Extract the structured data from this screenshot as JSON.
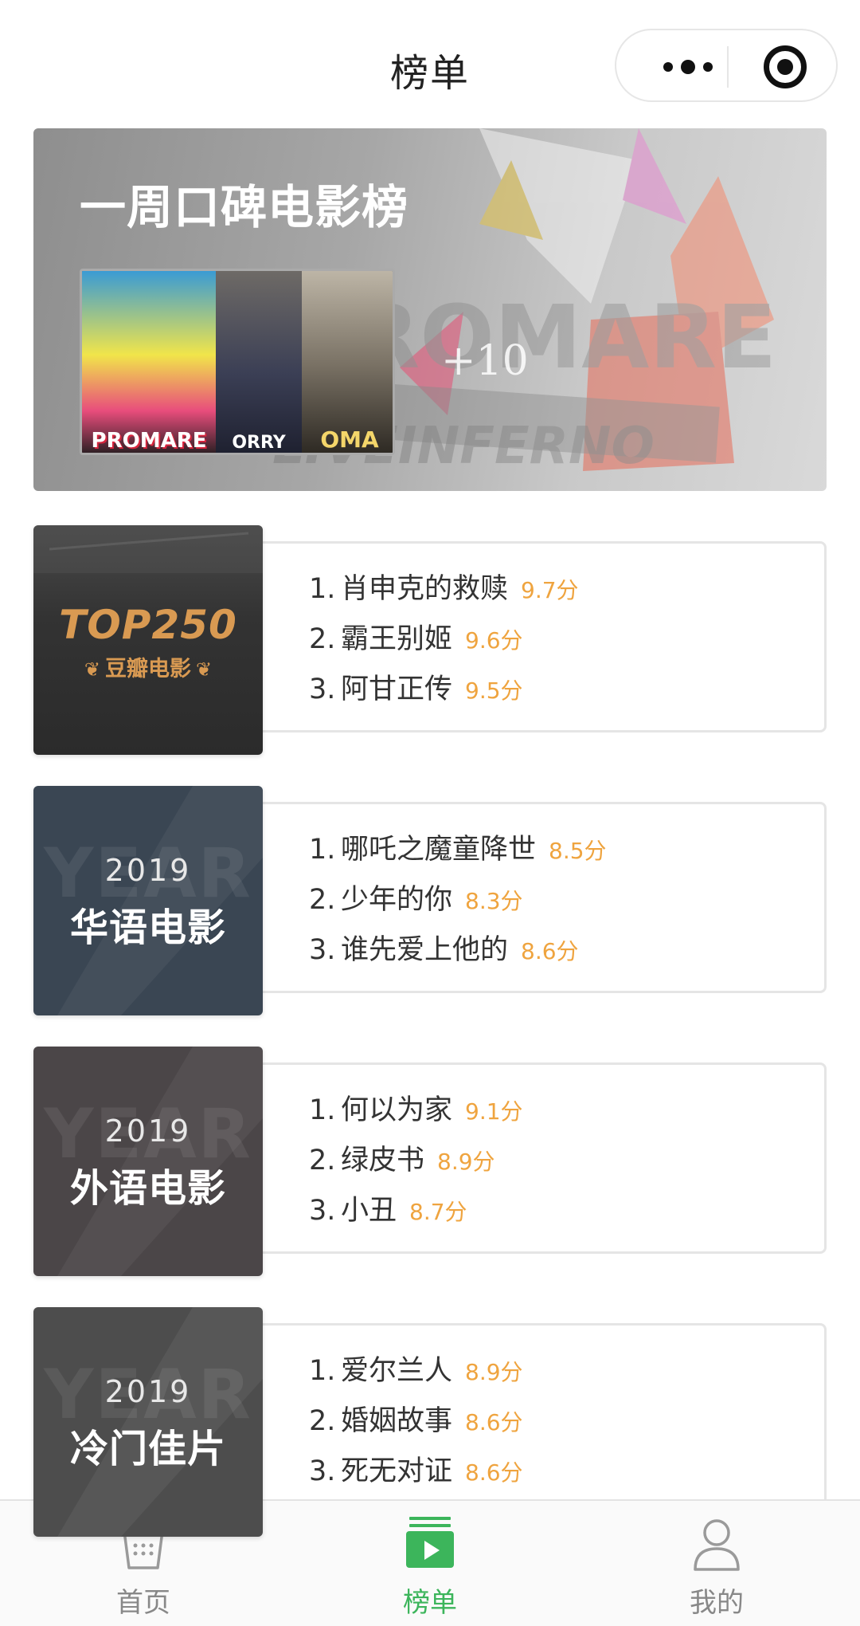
{
  "nav": {
    "title": "榜单"
  },
  "banner": {
    "title": "一周口碑电影榜",
    "more": "+10",
    "posters": [
      {
        "caption": "PROMARE",
        "icon": "poster-promare"
      },
      {
        "caption": "ORRY",
        "icon": "poster-sorry-we-missed-you"
      },
      {
        "caption": "OMA",
        "icon": "poster-road-to-roma"
      }
    ]
  },
  "lists": [
    {
      "cover": {
        "logo": "TOP250",
        "sub": "豆瓣电影"
      },
      "items": [
        {
          "rank": "1.",
          "title": "肖申克的救赎",
          "score": "9.7分"
        },
        {
          "rank": "2.",
          "title": "霸王别姬",
          "score": "9.6分"
        },
        {
          "rank": "3.",
          "title": "阿甘正传",
          "score": "9.5分"
        }
      ]
    },
    {
      "cover": {
        "bg_text": "YEAR",
        "year": "2019",
        "name": "华语电影"
      },
      "items": [
        {
          "rank": "1.",
          "title": "哪吒之魔童降世",
          "score": "8.5分"
        },
        {
          "rank": "2.",
          "title": "少年的你",
          "score": "8.3分"
        },
        {
          "rank": "3.",
          "title": "谁先爱上他的",
          "score": "8.6分"
        }
      ]
    },
    {
      "cover": {
        "bg_text": "YEAR",
        "year": "2019",
        "name": "外语电影"
      },
      "items": [
        {
          "rank": "1.",
          "title": "何以为家",
          "score": "9.1分"
        },
        {
          "rank": "2.",
          "title": "绿皮书",
          "score": "8.9分"
        },
        {
          "rank": "3.",
          "title": "小丑",
          "score": "8.7分"
        }
      ]
    },
    {
      "cover": {
        "bg_text": "YEAR",
        "year": "2019",
        "name": "冷门佳片"
      },
      "items": [
        {
          "rank": "1.",
          "title": "爱尔兰人",
          "score": "8.9分"
        },
        {
          "rank": "2.",
          "title": "婚姻故事",
          "score": "8.6分"
        },
        {
          "rank": "3.",
          "title": "死无对证",
          "score": "8.6分"
        }
      ]
    }
  ],
  "tabbar": {
    "tabs": [
      {
        "label": "首页",
        "icon": "popcorn-icon",
        "active": false
      },
      {
        "label": "榜单",
        "icon": "ranking-play-icon",
        "active": true
      },
      {
        "label": "我的",
        "icon": "user-icon",
        "active": false
      }
    ]
  },
  "colors": {
    "accent": "#3cb55b",
    "score": "#efa43f",
    "gold": "#d99a52"
  }
}
